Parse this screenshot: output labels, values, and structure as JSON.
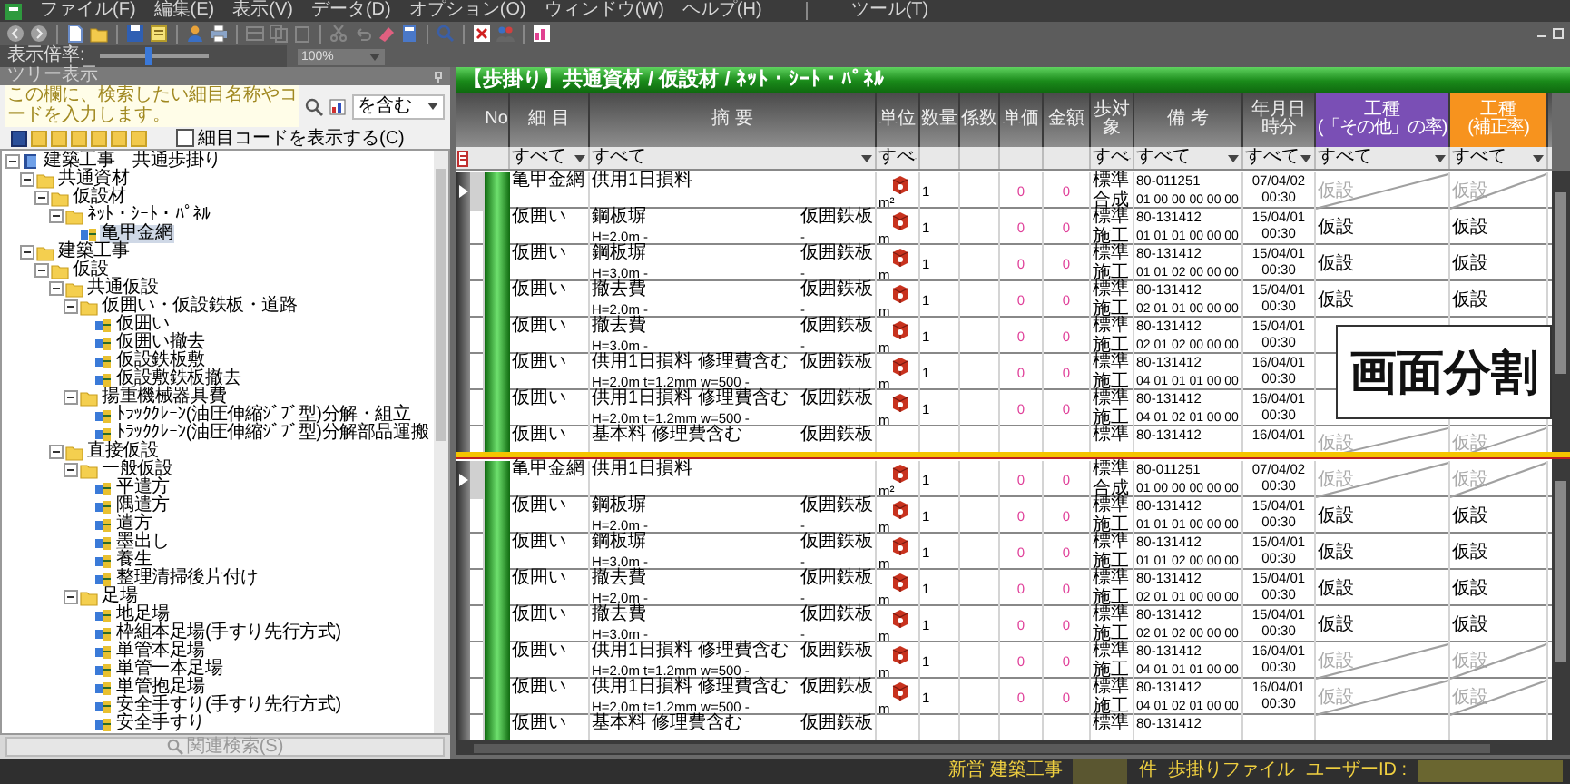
{
  "menu": {
    "items": [
      "ファイル(F)",
      "編集(E)",
      "表示(V)",
      "データ(D)",
      "オプション(O)",
      "ウィンドウ(W)",
      "ヘルプ(H)"
    ],
    "extra": [
      "ツール(T)"
    ]
  },
  "zoom": {
    "label": "表示倍率:",
    "level": 0.45,
    "value": "100%"
  },
  "tree_panel": {
    "title": "ツリー表示",
    "search": {
      "placeholder": "この欄に、検索したい細目名称やコードを入力します。",
      "mode": "を含む"
    },
    "level_buttons": [
      {
        "selected": true
      },
      {
        "selected": false
      },
      {
        "selected": false
      },
      {
        "selected": false
      },
      {
        "selected": false
      },
      {
        "selected": false
      },
      {
        "selected": false
      }
    ],
    "show_code": {
      "label": "細目コードを表示する(C)",
      "checked": false
    },
    "tree": [
      {
        "label": "建築工事　共通歩掛り",
        "kind": "root",
        "expanded": true,
        "selected": false,
        "children": [
          {
            "label": "共通資材",
            "kind": "folder",
            "expanded": true,
            "selected": false,
            "children": [
              {
                "label": "仮設材",
                "kind": "folder",
                "expanded": true,
                "selected": false,
                "children": [
                  {
                    "label": "ﾈｯﾄ・ｼｰﾄ・ﾊﾟﾈﾙ",
                    "kind": "folder",
                    "expanded": true,
                    "selected": false,
                    "children": [
                      {
                        "label": "亀甲金網",
                        "kind": "item",
                        "selected": true
                      }
                    ]
                  }
                ]
              }
            ]
          },
          {
            "label": "建築工事",
            "kind": "folder",
            "expanded": true,
            "selected": false,
            "children": [
              {
                "label": "仮設",
                "kind": "folder",
                "expanded": true,
                "selected": false,
                "children": [
                  {
                    "label": "共通仮設",
                    "kind": "folder",
                    "expanded": true,
                    "selected": false,
                    "children": [
                      {
                        "label": "仮囲い・仮設鉄板・道路",
                        "kind": "folder",
                        "expanded": true,
                        "selected": false,
                        "children": [
                          {
                            "label": "仮囲い",
                            "kind": "item",
                            "selected": false
                          },
                          {
                            "label": "仮囲い撤去",
                            "kind": "item",
                            "selected": false
                          },
                          {
                            "label": "仮設鉄板敷",
                            "kind": "item",
                            "selected": false
                          },
                          {
                            "label": "仮設敷鉄板撤去",
                            "kind": "item",
                            "selected": false
                          }
                        ]
                      },
                      {
                        "label": "揚重機械器具費",
                        "kind": "folder",
                        "expanded": true,
                        "selected": false,
                        "children": [
                          {
                            "label": "ﾄﾗｯｸｸﾚｰﾝ(油圧伸縮ｼﾞﾌﾞ型)分解・組立",
                            "kind": "item",
                            "selected": false
                          },
                          {
                            "label": "ﾄﾗｯｸｸﾚｰﾝ(油圧伸縮ｼﾞﾌﾞ型)分解部品運搬",
                            "kind": "item",
                            "selected": false
                          }
                        ]
                      }
                    ]
                  },
                  {
                    "label": "直接仮設",
                    "kind": "folder",
                    "expanded": true,
                    "selected": false,
                    "children": [
                      {
                        "label": "一般仮設",
                        "kind": "folder",
                        "expanded": true,
                        "selected": false,
                        "children": [
                          {
                            "label": "平遣方",
                            "kind": "item",
                            "selected": false
                          },
                          {
                            "label": "隅遣方",
                            "kind": "item",
                            "selected": false
                          },
                          {
                            "label": "遣方",
                            "kind": "item",
                            "selected": false
                          },
                          {
                            "label": "墨出し",
                            "kind": "item",
                            "selected": false
                          },
                          {
                            "label": "養生",
                            "kind": "item",
                            "selected": false
                          },
                          {
                            "label": "整理清掃後片付け",
                            "kind": "item",
                            "selected": false
                          }
                        ]
                      },
                      {
                        "label": "足場",
                        "kind": "folder",
                        "expanded": true,
                        "selected": false,
                        "children": [
                          {
                            "label": "地足場",
                            "kind": "item",
                            "selected": false
                          },
                          {
                            "label": "枠組本足場(手すり先行方式)",
                            "kind": "item",
                            "selected": false
                          },
                          {
                            "label": "単管本足場",
                            "kind": "item",
                            "selected": false
                          },
                          {
                            "label": "単管一本足場",
                            "kind": "item",
                            "selected": false
                          },
                          {
                            "label": "単管抱足場",
                            "kind": "item",
                            "selected": false
                          },
                          {
                            "label": "安全手すり(手すり先行方式)",
                            "kind": "item",
                            "selected": false
                          },
                          {
                            "label": "安全手すり",
                            "kind": "item",
                            "selected": false
                          }
                        ]
                      }
                    ]
                  }
                ]
              }
            ]
          }
        ]
      }
    ],
    "search_button": "関連検索(S)"
  },
  "table": {
    "title": "【歩掛り】共通資材 / 仮設材 / ﾈｯﾄ・ｼｰﾄ・ﾊﾟﾈﾙ",
    "columns": [
      {
        "label": "No"
      },
      {
        "label": "細 目",
        "filter": "すべて"
      },
      {
        "label": "摘 要",
        "filter": "すべて"
      },
      {
        "label": "単位",
        "filter": "すべ"
      },
      {
        "label": "数量"
      },
      {
        "label": "係数"
      },
      {
        "label": "単価"
      },
      {
        "label": "金額"
      },
      {
        "label": "歩対象",
        "filter": "すべ"
      },
      {
        "label": "備 考",
        "filter": "すべて"
      },
      {
        "label": "年月日",
        "label2": "時分",
        "filter": "すべて"
      },
      {
        "label": "工種",
        "label2": "(「その他」の率)",
        "color": "#7a4fb5",
        "filter": "すべて"
      },
      {
        "label": "工種",
        "label2": "(補正率)",
        "color": "#f7931e",
        "filter": "すべて"
      }
    ],
    "panes": [
      {
        "rows": [
          {
            "current": true,
            "item": "亀甲金網",
            "spec": "供用1日損料",
            "unit": "m²",
            "qty": "1",
            "price": "0",
            "amount": "0",
            "std": "標準",
            "std2": "合成",
            "code": "80-011251",
            "code2": "01 00 00 00 00 00",
            "date": "07/04/02",
            "time": "00:30",
            "work1": "仮設",
            "work2": "仮設",
            "inactive": true
          },
          {
            "current": false,
            "item": "仮囲い",
            "spec": "鋼板塀",
            "note": "仮囲鉄板",
            "spec2": "H=2.0m -",
            "note2": "-",
            "unit": "m",
            "qty": "1",
            "price": "0",
            "amount": "0",
            "std": "標準",
            "std2": "施工",
            "code": "80-131412",
            "code2": "01 01 01 00 00 00",
            "date": "15/04/01",
            "time": "00:30",
            "work1": "仮設",
            "work2": "仮設",
            "inactive": false
          },
          {
            "current": false,
            "item": "仮囲い",
            "spec": "鋼板塀",
            "note": "仮囲鉄板",
            "spec2": "H=3.0m -",
            "note2": "-",
            "unit": "m",
            "qty": "1",
            "price": "0",
            "amount": "0",
            "std": "標準",
            "std2": "施工",
            "code": "80-131412",
            "code2": "01 01 02 00 00 00",
            "date": "15/04/01",
            "time": "00:30",
            "work1": "仮設",
            "work2": "仮設",
            "inactive": false
          },
          {
            "current": false,
            "item": "仮囲い",
            "spec": "撤去費",
            "note": "仮囲鉄板",
            "spec2": "H=2.0m -",
            "note2": "-",
            "unit": "m",
            "qty": "1",
            "price": "0",
            "amount": "0",
            "std": "標準",
            "std2": "施工",
            "code": "80-131412",
            "code2": "02 01 01 00 00 00",
            "date": "15/04/01",
            "time": "00:30",
            "work1": "仮設",
            "work2": "仮設",
            "inactive": false
          },
          {
            "current": false,
            "item": "仮囲い",
            "spec": "撤去費",
            "note": "仮囲鉄板",
            "spec2": "H=3.0m -",
            "note2": "-",
            "unit": "m",
            "qty": "1",
            "price": "0",
            "amount": "0",
            "std": "標準",
            "std2": "施工",
            "code": "80-131412",
            "code2": "02 01 02 00 00 00",
            "date": "15/04/01",
            "time": "00:30"
          },
          {
            "current": false,
            "item": "仮囲い",
            "spec": "供用1日損料 修理費含む",
            "note": "仮囲鉄板",
            "spec2": "H=2.0m t=1.2mm w=500 -",
            "unit": "m",
            "qty": "1",
            "price": "0",
            "amount": "0",
            "std": "標準",
            "std2": "施工",
            "code": "80-131412",
            "code2": "04 01 01 01 00 00",
            "date": "16/04/01",
            "time": "00:30"
          },
          {
            "current": false,
            "item": "仮囲い",
            "spec": "供用1日損料 修理費含む",
            "note": "仮囲鉄板",
            "spec2": "H=2.0m t=1.2mm w=500 -",
            "unit": "m",
            "qty": "1",
            "price": "0",
            "amount": "0",
            "std": "標準",
            "std2": "施工",
            "code": "80-131412",
            "code2": "04 01 02 01 00 00",
            "date": "16/04/01",
            "time": "00:30"
          },
          {
            "current": false,
            "item": "仮囲い",
            "spec": "基本料 修理費含む",
            "note": "仮囲鉄板",
            "std": "標準",
            "code": "80-131412",
            "date": "16/04/01",
            "work1": "仮設",
            "work2": "仮設",
            "inactive": true
          }
        ]
      },
      {
        "rows": [
          {
            "current": true,
            "item": "亀甲金網",
            "spec": "供用1日損料",
            "unit": "m²",
            "qty": "1",
            "price": "0",
            "amount": "0",
            "std": "標準",
            "std2": "合成",
            "code": "80-011251",
            "code2": "01 00 00 00 00 00",
            "date": "07/04/02",
            "time": "00:30",
            "work1": "仮設",
            "work2": "仮設",
            "inactive": true
          },
          {
            "current": false,
            "item": "仮囲い",
            "spec": "鋼板塀",
            "note": "仮囲鉄板",
            "spec2": "H=2.0m -",
            "note2": "-",
            "unit": "m",
            "qty": "1",
            "price": "0",
            "amount": "0",
            "std": "標準",
            "std2": "施工",
            "code": "80-131412",
            "code2": "01 01 01 00 00 00",
            "date": "15/04/01",
            "time": "00:30",
            "work1": "仮設",
            "work2": "仮設",
            "inactive": false
          },
          {
            "current": false,
            "item": "仮囲い",
            "spec": "鋼板塀",
            "note": "仮囲鉄板",
            "spec2": "H=3.0m -",
            "note2": "-",
            "unit": "m",
            "qty": "1",
            "price": "0",
            "amount": "0",
            "std": "標準",
            "std2": "施工",
            "code": "80-131412",
            "code2": "01 01 02 00 00 00",
            "date": "15/04/01",
            "time": "00:30",
            "work1": "仮設",
            "work2": "仮設",
            "inactive": false
          },
          {
            "current": false,
            "item": "仮囲い",
            "spec": "撤去費",
            "note": "仮囲鉄板",
            "spec2": "H=2.0m -",
            "note2": "-",
            "unit": "m",
            "qty": "1",
            "price": "0",
            "amount": "0",
            "std": "標準",
            "std2": "施工",
            "code": "80-131412",
            "code2": "02 01 01 00 00 00",
            "date": "15/04/01",
            "time": "00:30",
            "work1": "仮設",
            "work2": "仮設",
            "inactive": false
          },
          {
            "current": false,
            "item": "仮囲い",
            "spec": "撤去費",
            "note": "仮囲鉄板",
            "spec2": "H=3.0m -",
            "note2": "-",
            "unit": "m",
            "qty": "1",
            "price": "0",
            "amount": "0",
            "std": "標準",
            "std2": "施工",
            "code": "80-131412",
            "code2": "02 01 02 00 00 00",
            "date": "15/04/01",
            "time": "00:30",
            "work1": "仮設",
            "work2": "仮設",
            "inactive": false
          },
          {
            "current": false,
            "item": "仮囲い",
            "spec": "供用1日損料 修理費含む",
            "note": "仮囲鉄板",
            "spec2": "H=2.0m t=1.2mm w=500 -",
            "unit": "m",
            "qty": "1",
            "price": "0",
            "amount": "0",
            "std": "標準",
            "std2": "施工",
            "code": "80-131412",
            "code2": "04 01 01 01 00 00",
            "date": "16/04/01",
            "time": "00:30",
            "work1": "仮設",
            "work2": "仮設",
            "inactive": true
          },
          {
            "current": false,
            "item": "仮囲い",
            "spec": "供用1日損料 修理費含む",
            "note": "仮囲鉄板",
            "spec2": "H=2.0m t=1.2mm w=500 -",
            "unit": "m",
            "qty": "1",
            "price": "0",
            "amount": "0",
            "std": "標準",
            "std2": "施工",
            "code": "80-131412",
            "code2": "04 01 02 01 00 00",
            "date": "16/04/01",
            "time": "00:30",
            "work1": "仮設",
            "work2": "仮設",
            "inactive": true
          },
          {
            "current": false,
            "item": "仮囲い",
            "spec": "基本料 修理費含む",
            "note": "仮囲鉄板",
            "std": "標準",
            "code": "80-131412"
          }
        ]
      }
    ]
  },
  "overlay_label": "画面分割",
  "status_bar": {
    "mode": "新営 建築工事",
    "count_unit": "件",
    "file": "歩掛りファイル",
    "user_label": "ユーザーID :"
  }
}
